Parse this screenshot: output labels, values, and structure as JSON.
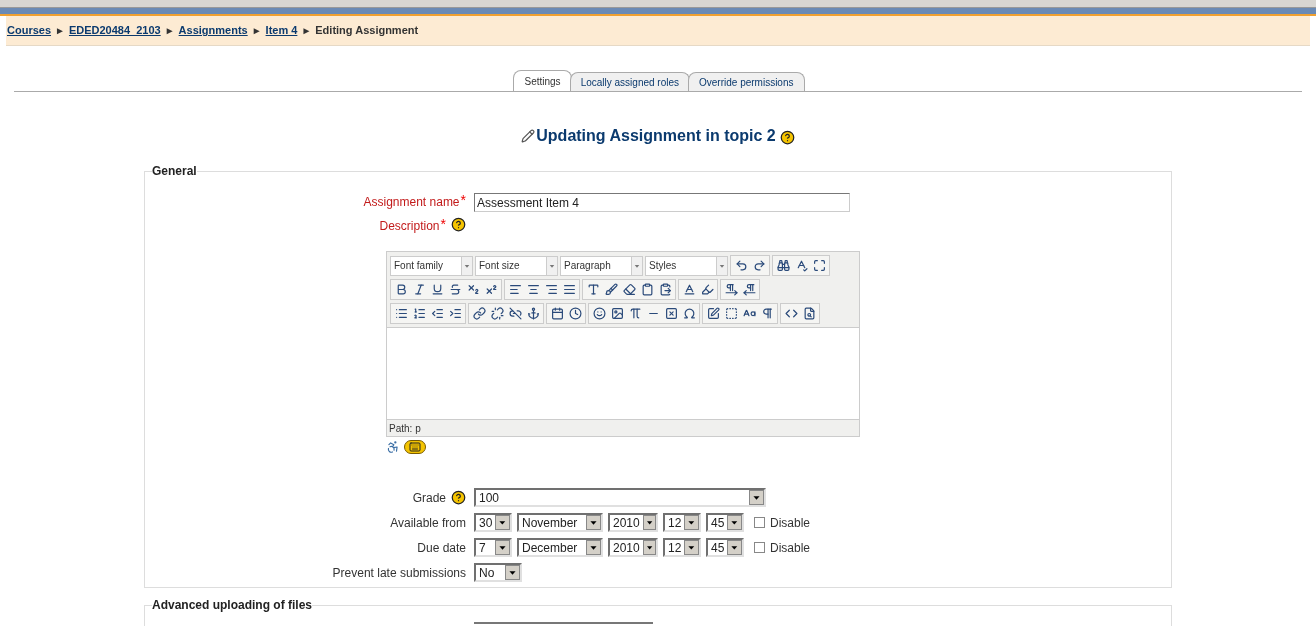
{
  "breadcrumb": [
    {
      "kind": "link",
      "text": "Courses"
    },
    {
      "kind": "sep",
      "text": "►"
    },
    {
      "kind": "link",
      "text": "EDED20484_2103"
    },
    {
      "kind": "sep",
      "text": "►"
    },
    {
      "kind": "link",
      "text": "Assignments"
    },
    {
      "kind": "sep",
      "text": "►"
    },
    {
      "kind": "link",
      "text": "Item 4"
    },
    {
      "kind": "sep",
      "text": "►"
    },
    {
      "kind": "current",
      "text": "Editing Assignment"
    }
  ],
  "tabs": [
    {
      "label": "Settings",
      "selected": true
    },
    {
      "label": "Locally assigned roles",
      "selected": false
    },
    {
      "label": "Override permissions",
      "selected": false
    }
  ],
  "heading": "Updating Assignment in topic 2",
  "general": {
    "legend": "General",
    "assignment_name": {
      "label": "Assignment name",
      "required_mark": "*",
      "value": "Assessment Item 4"
    },
    "description": {
      "label": "Description",
      "required_mark": "*"
    },
    "editor": {
      "dropdowns": [
        "Font family",
        "Font size",
        "Paragraph",
        "Styles"
      ],
      "path": "Path: p"
    },
    "grade": {
      "label": "Grade",
      "value": "100"
    },
    "dates": [
      {
        "label": "Available from",
        "selects": [
          "30",
          "November",
          "2010",
          "12",
          "45"
        ],
        "disable_label": "Disable",
        "disable_checked": false
      },
      {
        "label": "Due date",
        "selects": [
          "7",
          "December",
          "2010",
          "12",
          "45"
        ],
        "disable_label": "Disable",
        "disable_checked": false
      }
    ],
    "prevent_late": {
      "label": "Prevent late submissions",
      "value": "No"
    }
  },
  "advanced": {
    "legend": "Advanced uploading of files"
  }
}
